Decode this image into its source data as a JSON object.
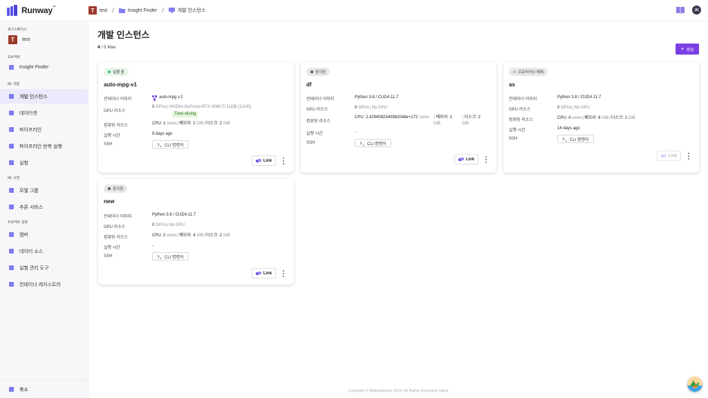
{
  "brand": {
    "name": "Runway",
    "tm": "™"
  },
  "breadcrumb": [
    {
      "label": "test",
      "badge": "T"
    },
    {
      "label": "Insight Finder"
    },
    {
      "label": "개발 인스턴스"
    }
  ],
  "header": {
    "avatar_initials": "JK"
  },
  "sidebar": {
    "workspace_section": "워크스페이스",
    "workspace": {
      "badge": "T",
      "label": "test"
    },
    "project_section": "프로젝트",
    "project_item": "Insight Finder",
    "ml_dev_section": "ML 개발",
    "ml_dev_items": [
      "개발 인스턴스",
      "데이터셋",
      "파이프라인",
      "파이프라인 반복 실행",
      "실험"
    ],
    "ml_serving_section": "ML 서빙",
    "ml_serving_items": [
      "모델 그룹",
      "추론 서비스"
    ],
    "project_settings_section": "프로젝트 설정",
    "project_settings_items": [
      "멤버",
      "데이터 소스",
      "실험 관리 도구",
      "컨테이너 레지스트리"
    ],
    "collapse_label": "축소"
  },
  "page": {
    "title": "개발 인스턴스",
    "count_current": "4",
    "count_rest": " / 5 Max",
    "create_label": "생성"
  },
  "labels": {
    "container_image": "컨테이너 이미지",
    "gpu": "GPU 리소스",
    "compute": "컴퓨팅 리소스",
    "runtime": "실행 시간",
    "ssh": "SSH",
    "cli": "CLI 명령어",
    "link": "Link",
    "cpu": "CPU:",
    "cores": "cores",
    "gpus": "GPUs",
    "memory": "메모리:",
    "disk": "디스크:",
    "gib": "GiB"
  },
  "cards": [
    {
      "status": "실행 중",
      "name": "auto-mpg-v1",
      "image": "auto-mpg v.1",
      "gpu_count": "0",
      "gpu_detail": "NVIDIA-GeForce-RTX-2080-Ti 11GB (1/100)",
      "gpu_tag": "Time slicing",
      "cpu": "1",
      "memory": "2",
      "disk": "2",
      "runtime": "9 days ago"
    },
    {
      "status": "중지됨",
      "name": "df",
      "image": "Python 3.8 / CUDA 11.7",
      "gpu_count": "0",
      "gpu_detail": "No GPU",
      "cpu": "2.4294082340982048e+172",
      "memory": "2",
      "disk": "2",
      "runtime": "-"
    },
    {
      "status": "프로비저닝 해제",
      "name": "as",
      "image": "Python 3.8 / CUDA 11.7",
      "gpu_count": "0",
      "gpu_detail": "No GPU",
      "cpu": "4",
      "memory": "8",
      "disk": "2",
      "runtime": "14 days ago"
    },
    {
      "status": "중지됨",
      "name": "new",
      "image": "Python 3.8 / CUDA 11.7",
      "gpu_count": "0",
      "gpu_detail": "No GPU",
      "cpu": "2",
      "memory": "4",
      "disk": "2",
      "runtime": "-"
    }
  ],
  "footer": {
    "copyright": "Copyright © MakinaRocks 2024. All Rights Reserved. latest"
  },
  "colors": {
    "accent": "#7b3fe4",
    "brand": "#5b57e8",
    "running": "#34c759",
    "workspace_badge": "#9c3b2c"
  }
}
